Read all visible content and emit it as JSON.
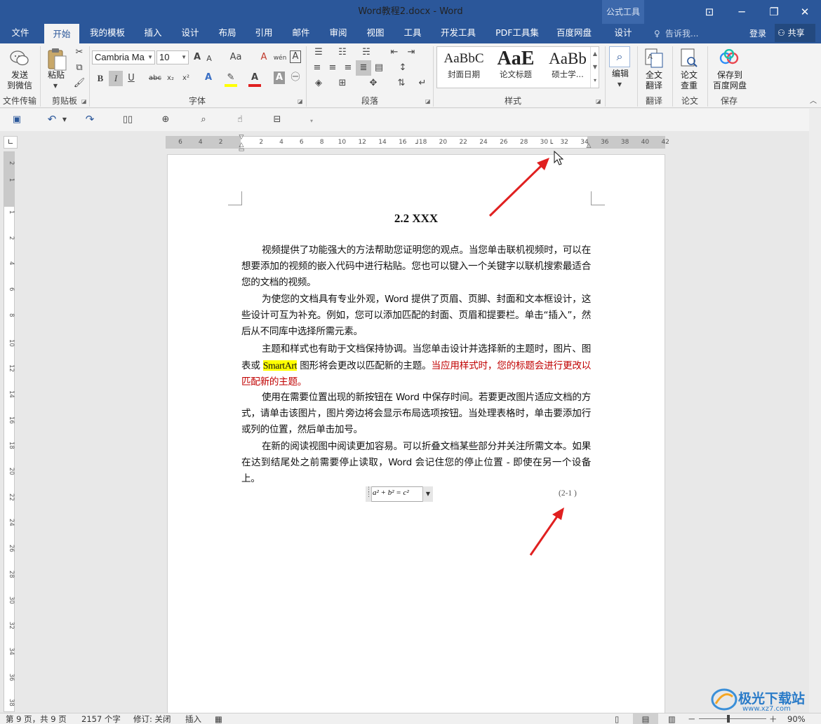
{
  "window": {
    "title": "Word教程2.docx - Word",
    "context_group": "公式工具",
    "minimize": "─",
    "restore": "❐",
    "close": "✕",
    "ribbon_opts": "⊡"
  },
  "tabs": [
    {
      "label": "文件"
    },
    {
      "label": "开始"
    },
    {
      "label": "我的模板"
    },
    {
      "label": "插入"
    },
    {
      "label": "设计"
    },
    {
      "label": "布局"
    },
    {
      "label": "引用"
    },
    {
      "label": "邮件"
    },
    {
      "label": "审阅"
    },
    {
      "label": "视图"
    },
    {
      "label": "工具"
    },
    {
      "label": "开发工具"
    },
    {
      "label": "PDF工具集"
    },
    {
      "label": "百度网盘"
    },
    {
      "label": "设计"
    }
  ],
  "tellme": "告诉我...",
  "login": "登录",
  "share": "共享",
  "ribbon": {
    "send_wechat": [
      "发送",
      "到微信"
    ],
    "paste": "粘贴",
    "font_name": "Cambria Ma",
    "font_size": "10",
    "edit": "编辑",
    "translate": [
      "全文",
      "翻译"
    ],
    "paper_check": [
      "论文",
      "查重"
    ],
    "save_baidu": [
      "保存到",
      "百度网盘"
    ],
    "groups": {
      "file_transfer": "文件传输",
      "clipboard": "剪贴板",
      "font": "字体",
      "paragraph": "段落",
      "styles": "样式",
      "translate": "翻译",
      "paper": "论文",
      "save": "保存"
    },
    "styles": [
      {
        "sample": "AaBbC",
        "name": "封面日期"
      },
      {
        "sample": "AaE",
        "name": "论文标题"
      },
      {
        "sample": "AaBb",
        "name": "硕士学..."
      }
    ],
    "glyphs": {
      "bold": "B",
      "italic": "I",
      "underline": "U",
      "strike": "abc",
      "sub": "x₂",
      "sup": "x²",
      "font_color": "A",
      "grow": "A",
      "shrink": "A",
      "case": "Aa",
      "clear": "A",
      "phonetic": "wén",
      "border_char": "A"
    }
  },
  "ruler": {
    "labels": [
      "6",
      "4",
      "2",
      "2",
      "4",
      "6",
      "8",
      "10",
      "12",
      "14",
      "16",
      "18",
      "20",
      "22",
      "24",
      "26",
      "28",
      "30",
      "32",
      "34",
      "36",
      "38",
      "40",
      "42"
    ]
  },
  "vruler": {
    "labels": [
      "2",
      "1",
      "1",
      "2",
      "4",
      "6",
      "8",
      "10",
      "12",
      "14",
      "16",
      "18",
      "20",
      "22",
      "24",
      "26",
      "28",
      "30",
      "32",
      "34",
      "36",
      "38"
    ]
  },
  "document": {
    "heading": "2.2 XXX",
    "p1": "视频提供了功能强大的方法帮助您证明您的观点。当您单击联机视频时，可以在想要添加的视频的嵌入代码中进行粘贴。您也可以键入一个关键字以联机搜索最适合您的文档的视频。",
    "p2": "为使您的文档具有专业外观，Word 提供了页眉、页脚、封面和文本框设计，这些设计可互为补充。例如，您可以添加匹配的封面、页眉和提要栏。单击“插入”，然后从不同库中选择所需元素。",
    "p3a": "主题和样式也有助于文档保持协调。当您单击设计并选择新的主题时，图片、图表或 ",
    "p3hl": "SmartArt",
    "p3b": " 图形将会更改以匹配新的主题。",
    "p3red": "当应用样式时，您的标题会进行更改以匹配新的主题。",
    "p4": "使用在需要位置出现的新按钮在 Word 中保存时间。若要更改图片适应文档的方式，请单击该图片，图片旁边将会显示布局选项按钮。当处理表格时，单击要添加行或列的位置，然后单击加号。",
    "p5": "在新的阅读视图中阅读更加容易。可以折叠文档某些部分并关注所需文本。如果在达到结尾处之前需要停止读取，Word 会记住您的停止位置 - 即使在另一个设备上。",
    "equation": "a² + b² = c²",
    "eq_number": "(2-1 )"
  },
  "status": {
    "page": "第 9 页，共 9 页",
    "words": "2157 个字",
    "revision": "修订: 关闭",
    "insert": "插入",
    "zoom": "90%",
    "zoom_minus": "－",
    "zoom_plus": "＋"
  },
  "watermark": {
    "brand": "极光下载站",
    "url": "www.xz7.com"
  },
  "colors": {
    "accent": "#2b579a",
    "arrow": "#e02020",
    "highlight": "#ffff00",
    "red_text": "#c00000"
  }
}
